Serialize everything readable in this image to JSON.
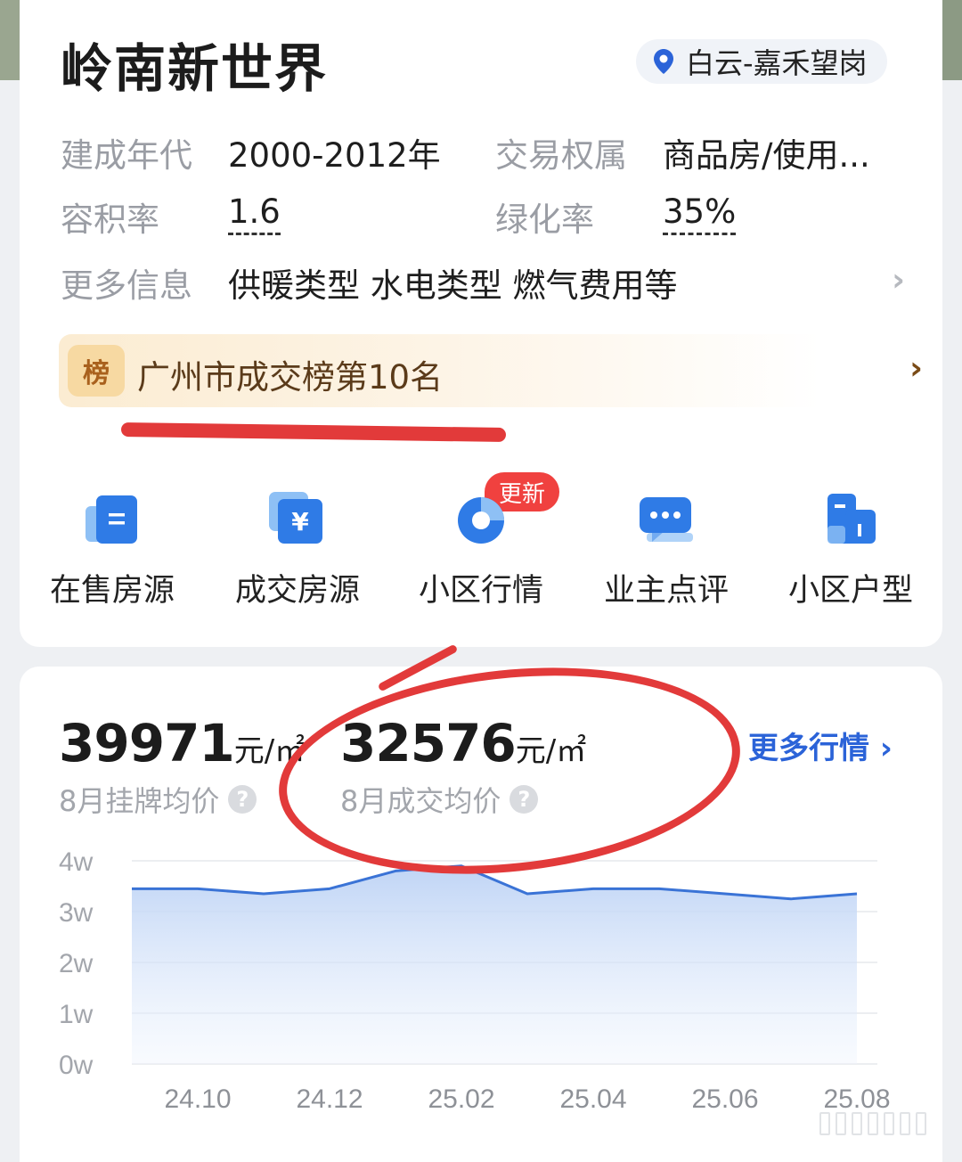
{
  "header": {
    "title": "岭南新世界",
    "location": "白云-嘉禾望岗"
  },
  "info": {
    "built_label": "建成年代",
    "built_value": "2000-2012年",
    "ownership_label": "交易权属",
    "ownership_value": "商品房/使用...",
    "far_label": "容积率",
    "far_value": "1.6",
    "green_label": "绿化率",
    "green_value": "35%",
    "more_label": "更多信息",
    "more_value": "供暖类型 水电类型 燃气费用等"
  },
  "rank": {
    "badge": "榜",
    "text": "广州市成交榜第10名"
  },
  "nav": [
    {
      "label": "在售房源",
      "icon": "listing-icon"
    },
    {
      "label": "成交房源",
      "icon": "deal-icon"
    },
    {
      "label": "小区行情",
      "icon": "market-icon",
      "badge": "更新"
    },
    {
      "label": "业主点评",
      "icon": "comment-icon"
    },
    {
      "label": "小区户型",
      "icon": "floorplan-icon"
    }
  ],
  "prices": {
    "listing_value": "39971",
    "listing_unit": "元/㎡",
    "listing_label": "8月挂牌均价",
    "deal_value": "32576",
    "deal_unit": "元/㎡",
    "deal_label": "8月成交均价",
    "more_link": "更多行情",
    "qmark": "?"
  },
  "colors": {
    "accent": "#2b63d8",
    "line": "#3a73d6",
    "annotation_red": "#e23a3a"
  },
  "chart_data": {
    "type": "area",
    "x": [
      "24.09",
      "24.10",
      "24.11",
      "24.12",
      "25.01",
      "25.02",
      "25.03",
      "25.04",
      "25.05",
      "25.06",
      "25.07",
      "25.08"
    ],
    "x_tick_labels": [
      "24.10",
      "24.12",
      "25.02",
      "25.04",
      "25.06",
      "25.08"
    ],
    "series": [
      {
        "values": [
          3.45,
          3.45,
          3.35,
          3.45,
          3.8,
          3.9,
          3.35,
          3.45,
          3.45,
          3.35,
          3.25,
          3.35
        ]
      }
    ],
    "y_tick_labels": [
      "4w",
      "3w",
      "2w",
      "1w",
      "0w"
    ],
    "ylim": [
      0,
      4
    ],
    "grid": true
  }
}
